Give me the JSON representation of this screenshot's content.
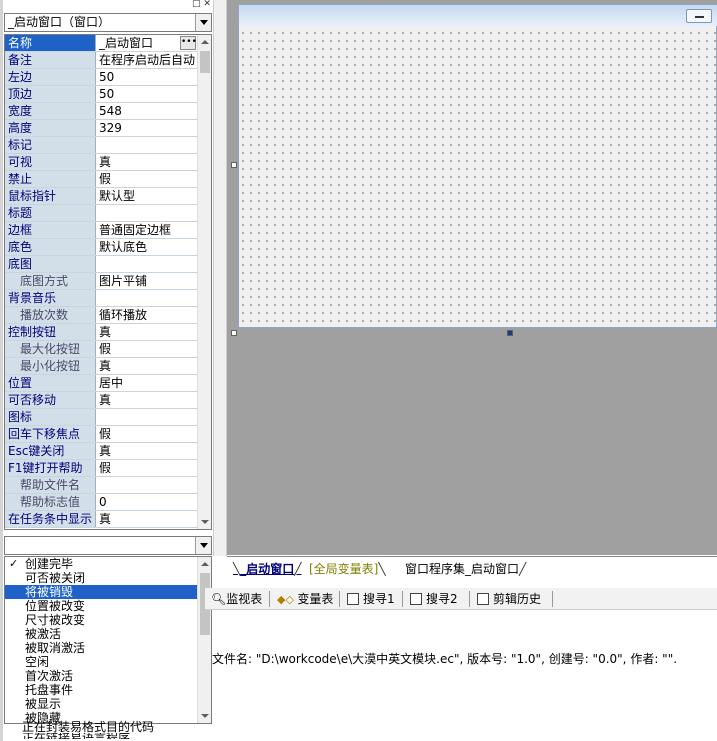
{
  "object_selector": {
    "value": "_启动窗口（窗口）"
  },
  "properties": [
    {
      "name": "名称",
      "value": "_启动窗口",
      "level": 0,
      "selected": true
    },
    {
      "name": "备注",
      "value": "在程序启动后自动",
      "level": 0
    },
    {
      "name": "左边",
      "value": "50",
      "level": 0
    },
    {
      "name": "顶边",
      "value": "50",
      "level": 0
    },
    {
      "name": "宽度",
      "value": "548",
      "level": 0
    },
    {
      "name": "高度",
      "value": "329",
      "level": 0
    },
    {
      "name": "标记",
      "value": "",
      "level": 0
    },
    {
      "name": "可视",
      "value": "真",
      "level": 0
    },
    {
      "name": "禁止",
      "value": "假",
      "level": 0
    },
    {
      "name": "鼠标指针",
      "value": "默认型",
      "level": 0
    },
    {
      "name": "标题",
      "value": "",
      "level": 0
    },
    {
      "name": "边框",
      "value": "普通固定边框",
      "level": 0
    },
    {
      "name": "底色",
      "value": "默认底色",
      "level": 0
    },
    {
      "name": "底图",
      "value": "",
      "level": 0
    },
    {
      "name": "底图方式",
      "value": "图片平铺",
      "level": 1
    },
    {
      "name": "背景音乐",
      "value": "",
      "level": 0
    },
    {
      "name": "播放次数",
      "value": "循环播放",
      "level": 1
    },
    {
      "name": "控制按钮",
      "value": "真",
      "level": 0
    },
    {
      "name": "最大化按钮",
      "value": "假",
      "level": 1
    },
    {
      "name": "最小化按钮",
      "value": "真",
      "level": 1
    },
    {
      "name": "位置",
      "value": "居中",
      "level": 0
    },
    {
      "name": "可否移动",
      "value": "真",
      "level": 0
    },
    {
      "name": "图标",
      "value": "",
      "level": 0
    },
    {
      "name": "回车下移焦点",
      "value": "假",
      "level": 0
    },
    {
      "name": "Esc键关闭",
      "value": "真",
      "level": 0
    },
    {
      "name": "F1键打开帮助",
      "value": "假",
      "level": 0
    },
    {
      "name": "帮助文件名",
      "value": "",
      "level": 1
    },
    {
      "name": "帮助标志值",
      "value": "0",
      "level": 1
    },
    {
      "name": "在任务条中显示",
      "value": "真",
      "level": 0
    }
  ],
  "event_list": [
    {
      "label": "创建完毕",
      "checked": true
    },
    {
      "label": "可否被关闭"
    },
    {
      "label": "将被销毁",
      "selected": true
    },
    {
      "label": "位置被改变"
    },
    {
      "label": "尺寸被改变"
    },
    {
      "label": "被激活"
    },
    {
      "label": "被取消激活"
    },
    {
      "label": "空闲"
    },
    {
      "label": "首次激活"
    },
    {
      "label": "托盘事件"
    },
    {
      "label": "被显示"
    },
    {
      "label": "被隐藏"
    }
  ],
  "tabs": [
    {
      "label": "_启动窗口",
      "active": true
    },
    {
      "label": "[全局变量表]",
      "color": "#808000"
    },
    {
      "label": "窗口程序集_启动窗口"
    }
  ],
  "toolbar": [
    {
      "label": "监视表",
      "icon": "magnifier-icon"
    },
    {
      "label": "变量表",
      "icon": "variables-icon"
    },
    {
      "label": "搜寻1",
      "icon": "search-icon"
    },
    {
      "label": "搜寻2",
      "icon": "search-icon"
    },
    {
      "label": "剪辑历史",
      "icon": "clipboard-icon"
    }
  ],
  "output": {
    "line": "文件名: \"D:\\workcode\\e\\大漠中英文模块.ec\", 版本号: \"1.0\", 创建号: \"0.0\", 作者: \"\"."
  },
  "status": {
    "line1": "正在封装易格式目的代码",
    "line2": "正在链接易语言程序"
  },
  "colors": {
    "selection": "#1e62c8",
    "prop_name_bg": "#d2dee8",
    "designer_bg": "#a0a0a0"
  }
}
